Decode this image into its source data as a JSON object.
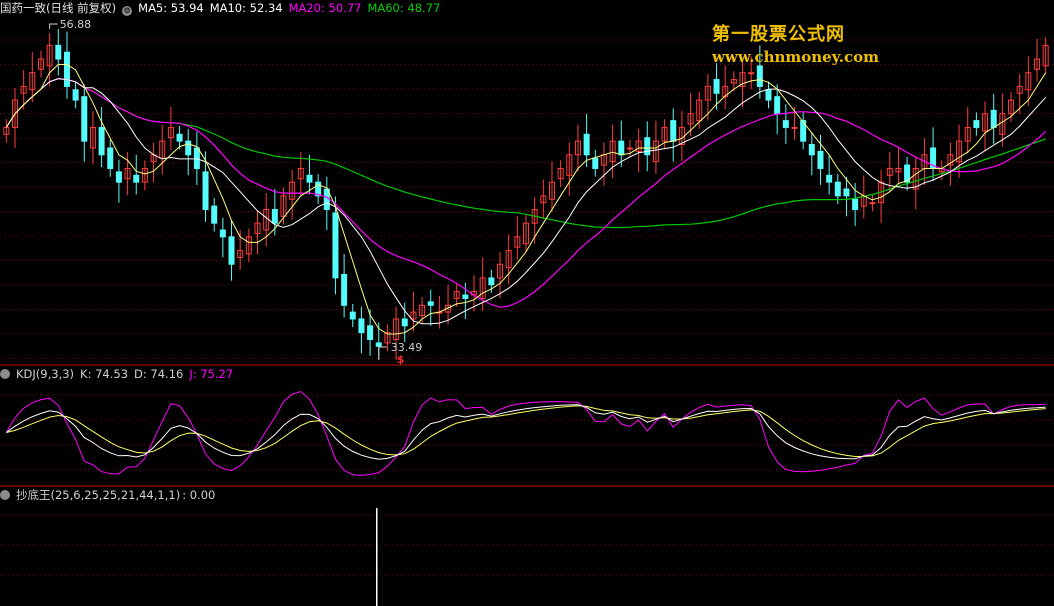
{
  "main_panel": {
    "title": "国药一致(日线 前复权)",
    "ma_labels": [
      {
        "text": "MA5: 53.94",
        "color": "#ffffff"
      },
      {
        "text": "MA10: 52.34",
        "color": "#ffffff"
      },
      {
        "text": "MA20: 50.77",
        "color": "#ff00ff"
      },
      {
        "text": "MA60: 48.77",
        "color": "#00d000"
      }
    ],
    "high_label": "56.88",
    "low_label": "33.49",
    "signal_marker": "$"
  },
  "kdj_panel": {
    "title": "KDJ(9,3,3)",
    "k_label": "K: 74.53",
    "d_label": "D: 74.16",
    "j_label": "J: 75.27",
    "j_color": "#ff00ff"
  },
  "bottom_panel": {
    "title": "抄底王(25,6,25,25,21,44,1,1)",
    "value": ": 0.00"
  },
  "watermark": {
    "line1": "第一股票公式网",
    "line2": "www.chnmoney.com"
  },
  "colors": {
    "up": "#ff3c3c",
    "down": "#54fcfc",
    "ma60": "#00c800",
    "ma20": "#ff00ff",
    "grid": "#7a0000",
    "divider": "#c00000"
  },
  "chart_data": [
    {
      "type": "candlestick",
      "title": "国药一致(日线 前复权)",
      "ylim": [
        33,
        58
      ],
      "closes": [
        50,
        52,
        53,
        54,
        55,
        56,
        55,
        53,
        52,
        49,
        50,
        48,
        47,
        46,
        47,
        46,
        47,
        48,
        49,
        50,
        49,
        48,
        47,
        44,
        43,
        42,
        40,
        41,
        42,
        43,
        44,
        43,
        45,
        46,
        47,
        46,
        45,
        44,
        39,
        37,
        36,
        35,
        34.5,
        34,
        35,
        36,
        35.5,
        36.5,
        37,
        37,
        36.5,
        37,
        38,
        37.5,
        38,
        39,
        38.5,
        40,
        41,
        42,
        43,
        44,
        45,
        46,
        47,
        48,
        49,
        48,
        47,
        48,
        49,
        48,
        48.5,
        49,
        48,
        49,
        50,
        49,
        50,
        51,
        52,
        53,
        52.5,
        53,
        53.5,
        54,
        54,
        53,
        52,
        51,
        50,
        50,
        49,
        48,
        47,
        46,
        45,
        45,
        44,
        45,
        44.5,
        46,
        47,
        47,
        46,
        47,
        48,
        47,
        47,
        48,
        49,
        50,
        50,
        51,
        50,
        51,
        52,
        53,
        54,
        55,
        56
      ]
    },
    {
      "type": "line",
      "title": "KDJ(9,3,3)",
      "series": [
        {
          "name": "K",
          "last": 74.53
        },
        {
          "name": "D",
          "last": 74.16
        },
        {
          "name": "J",
          "last": 75.27
        }
      ]
    },
    {
      "type": "bar",
      "title": "抄底王(25,6,25,25,21,44,1,1)",
      "last": 0.0
    }
  ]
}
